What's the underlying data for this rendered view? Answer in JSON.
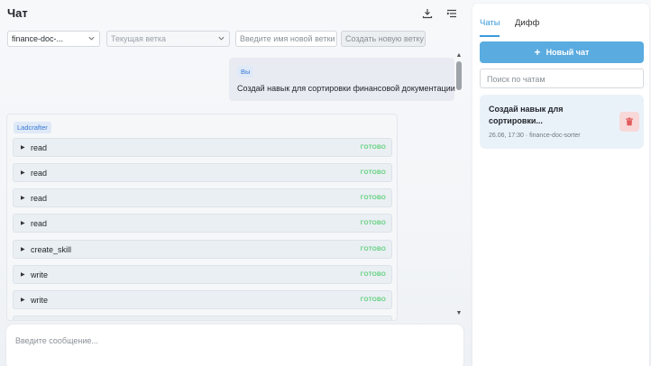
{
  "header": {
    "title": "Чат",
    "download_icon": "download-icon",
    "menu_icon": "list-menu-icon"
  },
  "controls": {
    "repo_select": "finance-doc-...",
    "branch_select_placeholder": "Текущая ветка",
    "new_branch_placeholder": "Введите имя новой ветки",
    "create_branch_button": "Создать новую ветку"
  },
  "messages": {
    "user": {
      "badge": "Вы",
      "text": "Создай навык для сортировки финансовой документации"
    },
    "agent": {
      "badge": "Ladcrafter",
      "tool_calls": [
        {
          "name": "read",
          "status": "ГОТОВО"
        },
        {
          "name": "read",
          "status": "ГОТОВО"
        },
        {
          "name": "read",
          "status": "ГОТОВО"
        },
        {
          "name": "read",
          "status": "ГОТОВО"
        },
        {
          "name": "create_skill",
          "status": "ГОТОВО"
        },
        {
          "name": "write",
          "status": "ГОТОВО"
        },
        {
          "name": "write",
          "status": "ГОТОВО"
        }
      ]
    }
  },
  "composer": {
    "placeholder": "Введите сообщение..."
  },
  "sidebar": {
    "tabs": [
      "Чаты",
      "Дифф"
    ],
    "active_tab": "Чаты",
    "new_chat_label": "Новый чат",
    "search_placeholder": "Поиск по чатам",
    "chats": [
      {
        "title": "Создай навык для сортировки...",
        "meta": "26.06, 17:30 · finance-doc-sorter"
      }
    ]
  },
  "colors": {
    "accent": "#5aabe0",
    "status_done": "#5fd07a",
    "delete": "#e05b5b"
  }
}
